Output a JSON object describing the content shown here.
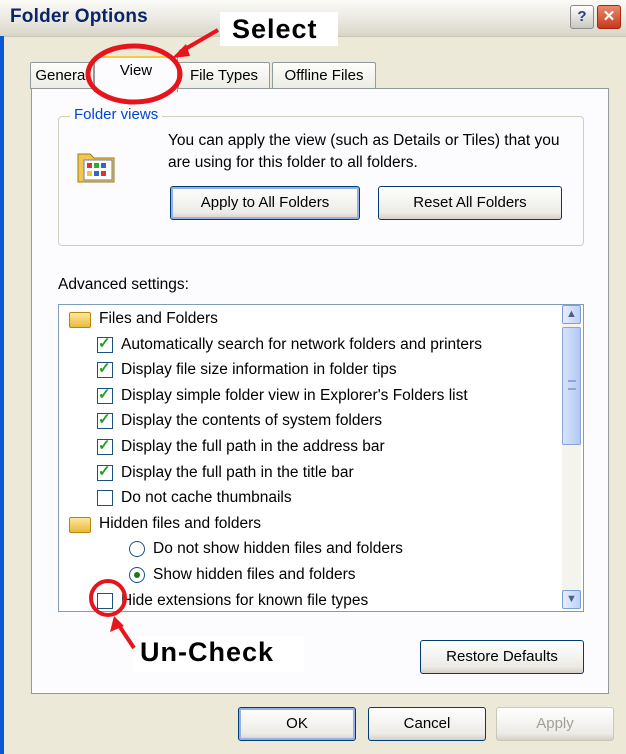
{
  "window": {
    "title": "Folder Options"
  },
  "caption_buttons": {
    "help": "?",
    "close": "✕"
  },
  "tabs": [
    {
      "label": "General",
      "selected": false
    },
    {
      "label": "View",
      "selected": true
    },
    {
      "label": "File Types",
      "selected": false
    },
    {
      "label": "Offline Files",
      "selected": false
    }
  ],
  "folder_views": {
    "legend": "Folder views",
    "description": "You can apply the view (such as Details or Tiles) that you are using for this folder to all folders.",
    "apply_all_label": "Apply to All Folders",
    "reset_all_label": "Reset All Folders"
  },
  "advanced": {
    "label": "Advanced settings:",
    "items": [
      {
        "type": "folder",
        "label": "Files and Folders"
      },
      {
        "type": "checkbox",
        "label": "Automatically search for network folders and printers",
        "checked": true,
        "tick": "✓"
      },
      {
        "type": "checkbox",
        "label": "Display file size information in folder tips",
        "checked": true,
        "tick": "✓"
      },
      {
        "type": "checkbox",
        "label": "Display simple folder view in Explorer's Folders list",
        "checked": true,
        "tick": "✓"
      },
      {
        "type": "checkbox",
        "label": "Display the contents of system folders",
        "checked": true,
        "tick": "✓"
      },
      {
        "type": "checkbox",
        "label": "Display the full path in the address bar",
        "checked": true,
        "tick": "✓"
      },
      {
        "type": "checkbox",
        "label": "Display the full path in the title bar",
        "checked": true,
        "tick": "✓"
      },
      {
        "type": "checkbox",
        "label": "Do not cache thumbnails",
        "checked": false,
        "tick": ""
      },
      {
        "type": "folder",
        "label": "Hidden files and folders"
      },
      {
        "type": "radio",
        "label": "Do not show hidden files and folders",
        "selected": false
      },
      {
        "type": "radio",
        "label": "Show hidden files and folders",
        "selected": true
      },
      {
        "type": "checkbox",
        "label": "Hide extensions for known file types",
        "checked": false,
        "tick": ""
      }
    ],
    "restore_label": "Restore Defaults"
  },
  "scroll": {
    "up": "▲",
    "down": "▼"
  },
  "footer": {
    "ok_label": "OK",
    "cancel_label": "Cancel",
    "apply_label": "Apply"
  },
  "annotations": {
    "select": "Select",
    "uncheck": "Un-Check",
    "color": "#e8141c"
  }
}
